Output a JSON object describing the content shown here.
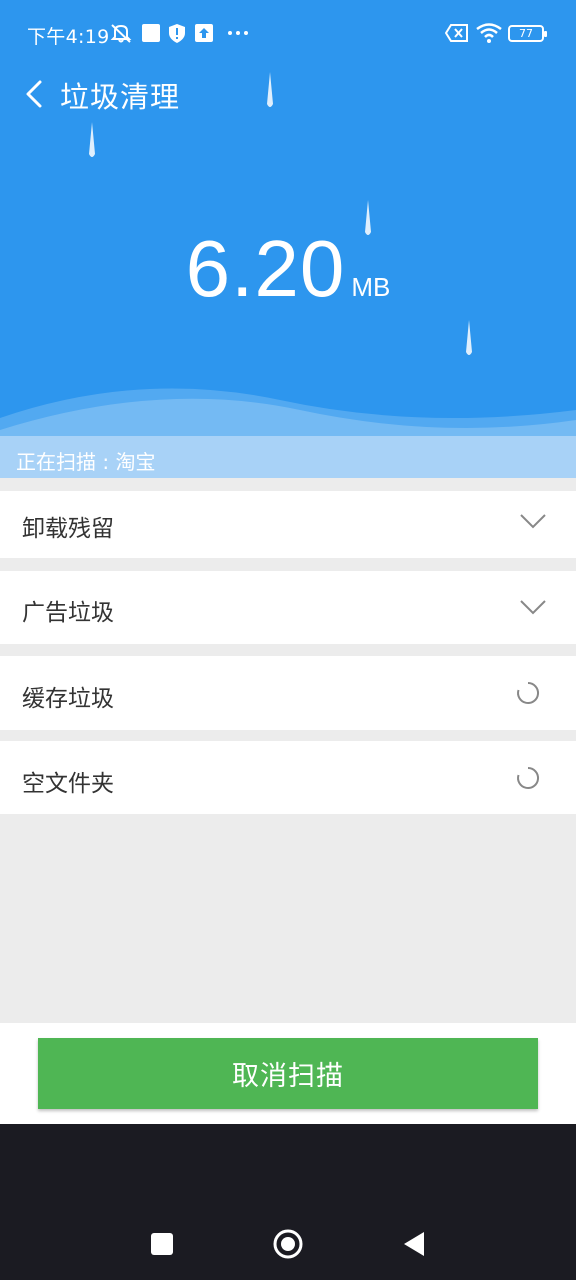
{
  "status_bar": {
    "time": "下午4:19",
    "icons": [
      "mute-icon",
      "square-notification-icon",
      "shield-icon",
      "upload-icon",
      "more-icon",
      "sim-off-icon",
      "wifi-icon"
    ],
    "battery": "77"
  },
  "header": {
    "back_icon": "chevron-left-icon",
    "title": "垃圾清理"
  },
  "scan_size": {
    "value": "6.20",
    "unit": "MB"
  },
  "scan_status": "正在扫描 : 淘宝",
  "categories": [
    {
      "label": "卸载残留",
      "state": "expand",
      "icon": "chevron-down-icon"
    },
    {
      "label": "广告垃圾",
      "state": "expand",
      "icon": "chevron-down-icon"
    },
    {
      "label": "缓存垃圾",
      "state": "scanning",
      "icon": "loading-spinner-icon"
    },
    {
      "label": "空文件夹",
      "state": "scanning",
      "icon": "loading-spinner-icon"
    }
  ],
  "cancel_button": "取消扫描",
  "nav": [
    "recents-icon",
    "home-icon",
    "back-icon"
  ],
  "colors": {
    "hero_blue": "#2d96ee",
    "scan_bar": "#a8d2f7",
    "button_green": "#4fb654",
    "nav_dark": "#1b1b22"
  }
}
